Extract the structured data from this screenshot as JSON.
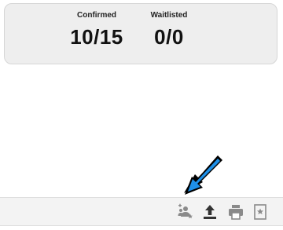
{
  "counts": {
    "confirmed_label": "Confirmed",
    "confirmed_value": "10/15",
    "waitlisted_label": "Waitlisted",
    "waitlisted_value": "0/0"
  },
  "toolbar": {
    "icons": [
      "add-people-icon",
      "upload-icon",
      "print-icon",
      "bookmark-star-icon"
    ]
  },
  "colors": {
    "card_bg": "#eeeeee",
    "icon_gray": "#8a8a8a",
    "icon_dark": "#333333",
    "arrow_blue": "#1e90e8"
  }
}
